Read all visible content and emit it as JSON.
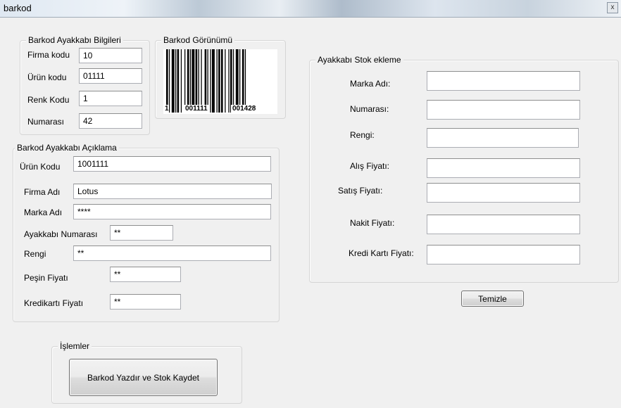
{
  "window": {
    "title": "barkod",
    "close_symbol": "x"
  },
  "bilgiler": {
    "legend": "Barkod Ayakkabı Bilgileri",
    "firma_kodu_label": "Firma kodu",
    "firma_kodu_value": "10",
    "urun_kodu_label": "Ürün kodu",
    "urun_kodu_value": "01111",
    "renk_kodu_label": "Renk Kodu",
    "renk_kodu_value": "1",
    "numarasi_label": "Numarası",
    "numarasi_value": "42"
  },
  "gorunum": {
    "legend": "Barkod Görünümü",
    "digit_left": "1",
    "group1": "001111",
    "group2": "001428"
  },
  "aciklama": {
    "legend": "Barkod Ayakkabı Açıklama",
    "urun_kodu_label": "Ürün Kodu",
    "urun_kodu_value": "1001111",
    "firma_adi_label": "Firma Adı",
    "firma_adi_value": "Lotus",
    "marka_adi_label": "Marka Adı",
    "marka_adi_value": "****",
    "numarasi_label": "Ayakkabı Numarası",
    "numarasi_value": "**",
    "rengi_label": "Rengi",
    "rengi_value": "**",
    "pesin_label": "Peşin Fiyatı",
    "pesin_value": "**",
    "kredi_label": "Kredikartı Fiyatı",
    "kredi_value": "**"
  },
  "stok": {
    "legend": "Ayakkabı Stok ekleme",
    "marka_label": "Marka Adı:",
    "marka_value": "",
    "numarasi_label": "Numarası:",
    "numarasi_value": "",
    "rengi_label": "Rengi:",
    "rengi_value": "",
    "alis_label": "Alış Fiyatı:",
    "alis_value": "",
    "satis_label": "Satış Fiyatı:",
    "satis_value": "",
    "nakit_label": "Nakit Fiyatı:",
    "nakit_value": "",
    "kredi_label": "Kredi Kartı Fiyatı:",
    "kredi_value": ""
  },
  "temizle_label": "Temizle",
  "islemler": {
    "legend": "İşlemler",
    "button_label": "Barkod Yazdır ve Stok Kaydet"
  }
}
